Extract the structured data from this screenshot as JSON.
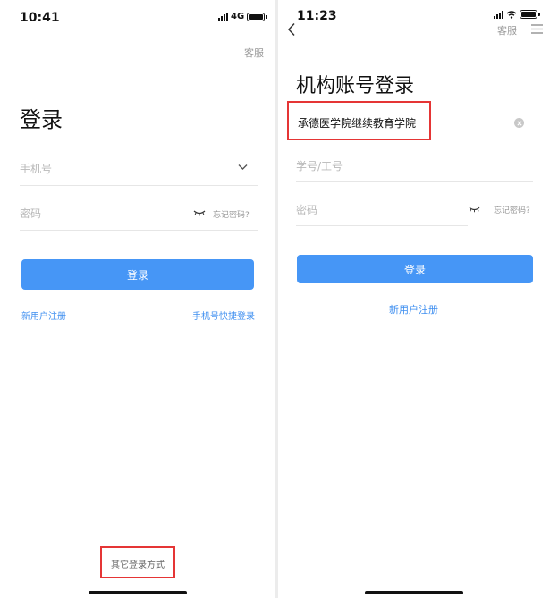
{
  "left": {
    "status": {
      "time": "10:41",
      "network": "4G"
    },
    "kefu": "客服",
    "title": "登录",
    "phone_placeholder": "手机号",
    "password_placeholder": "密码",
    "forgot_password": "忘记密码?",
    "login_button": "登录",
    "register_link": "新用户注册",
    "quick_login_link": "手机号快捷登录",
    "other_login": "其它登录方式"
  },
  "right": {
    "status": {
      "time": "11:23"
    },
    "kefu": "客服",
    "title": "机构账号登录",
    "institution_value": "承德医学院继续教育学院",
    "student_id_placeholder": "学号/工号",
    "password_placeholder": "密码",
    "forgot_password": "忘记密码?",
    "login_button": "登录",
    "register_link": "新用户注册"
  },
  "colors": {
    "accent": "#4696f6",
    "link": "#3f8ff0",
    "highlight": "#e53535"
  },
  "icons": [
    "signal-icon",
    "battery-icon",
    "wifi-icon",
    "chevron-down-icon",
    "eye-closed-icon",
    "back-icon",
    "menu-icon",
    "clear-icon"
  ]
}
